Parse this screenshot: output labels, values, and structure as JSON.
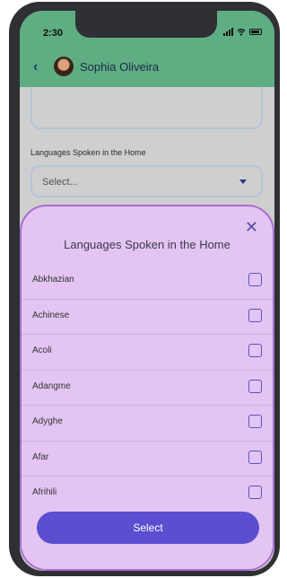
{
  "status_bar": {
    "time": "2:30"
  },
  "header": {
    "back_icon": "chevron-left-icon",
    "name": "Sophia Oliveira"
  },
  "form": {
    "languages_label": "Languages Spoken in the Home",
    "languages_placeholder": "Select..."
  },
  "modal": {
    "title": "Languages Spoken in the Home",
    "close_icon": "close-icon",
    "items": [
      {
        "label": "Abkhazian"
      },
      {
        "label": "Achinese"
      },
      {
        "label": "Acoli"
      },
      {
        "label": "Adangme"
      },
      {
        "label": "Adyghe"
      },
      {
        "label": "Afar"
      },
      {
        "label": "Afrihili"
      }
    ],
    "select_label": "Select"
  }
}
